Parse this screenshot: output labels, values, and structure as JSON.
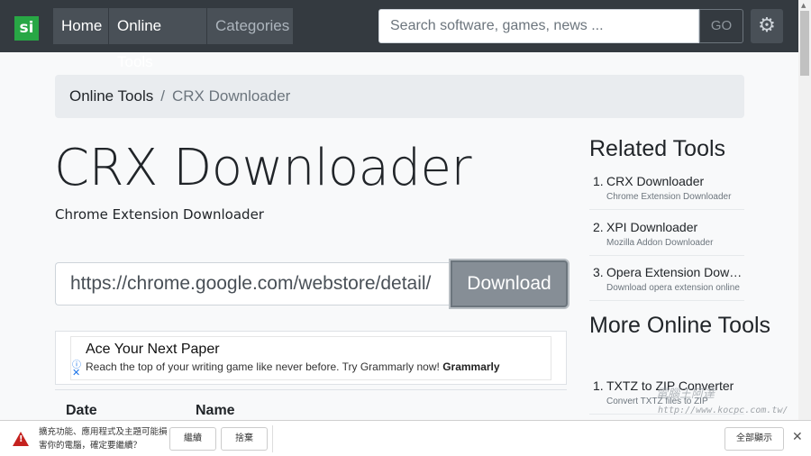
{
  "navbar": {
    "logo": "si",
    "home": "Home",
    "online_tools": "Online Tools",
    "categories": "Categories",
    "search_placeholder": "Search software, games, news ...",
    "go": "GO",
    "settings_icon": "gear-icon"
  },
  "breadcrumb": {
    "parent": "Online Tools",
    "separator": "/",
    "current": "CRX Downloader"
  },
  "main": {
    "title": "CRX Downloader",
    "subtitle": "Chrome Extension Downloader",
    "url_value": "https://chrome.google.com/webstore/detail/",
    "download_label": "Download"
  },
  "ad": {
    "title": "Ace Your Next Paper",
    "text": "Reach the top of your writing game like never before. Try Grammarly now!",
    "brand": "Grammarly"
  },
  "table": {
    "headers": [
      "Date",
      "Name"
    ]
  },
  "sidebar": {
    "related_heading": "Related Tools",
    "related": [
      {
        "num": "1.",
        "name": "CRX Downloader",
        "desc": "Chrome Extension Downloader"
      },
      {
        "num": "2.",
        "name": "XPI Downloader",
        "desc": "Mozilla Addon Downloader"
      },
      {
        "num": "3.",
        "name": "Opera Extension Downloader",
        "desc": "Download opera extension online"
      }
    ],
    "more_heading": "More Online Tools",
    "more": [
      {
        "num": "1.",
        "name": "TXTZ to ZIP Converter",
        "desc": "Convert TXTZ files to ZIP"
      }
    ]
  },
  "watermark": {
    "text": "電腦王阿達",
    "url": "http://www.kocpc.com.tw/"
  },
  "download_warning": {
    "message": "擴充功能、應用程式及主題可能損害你的電腦，確定要繼續？",
    "continue": "繼續",
    "discard": "捨棄",
    "show_all": "全部顯示",
    "close": "✕",
    "status_color": "#c5221f"
  }
}
